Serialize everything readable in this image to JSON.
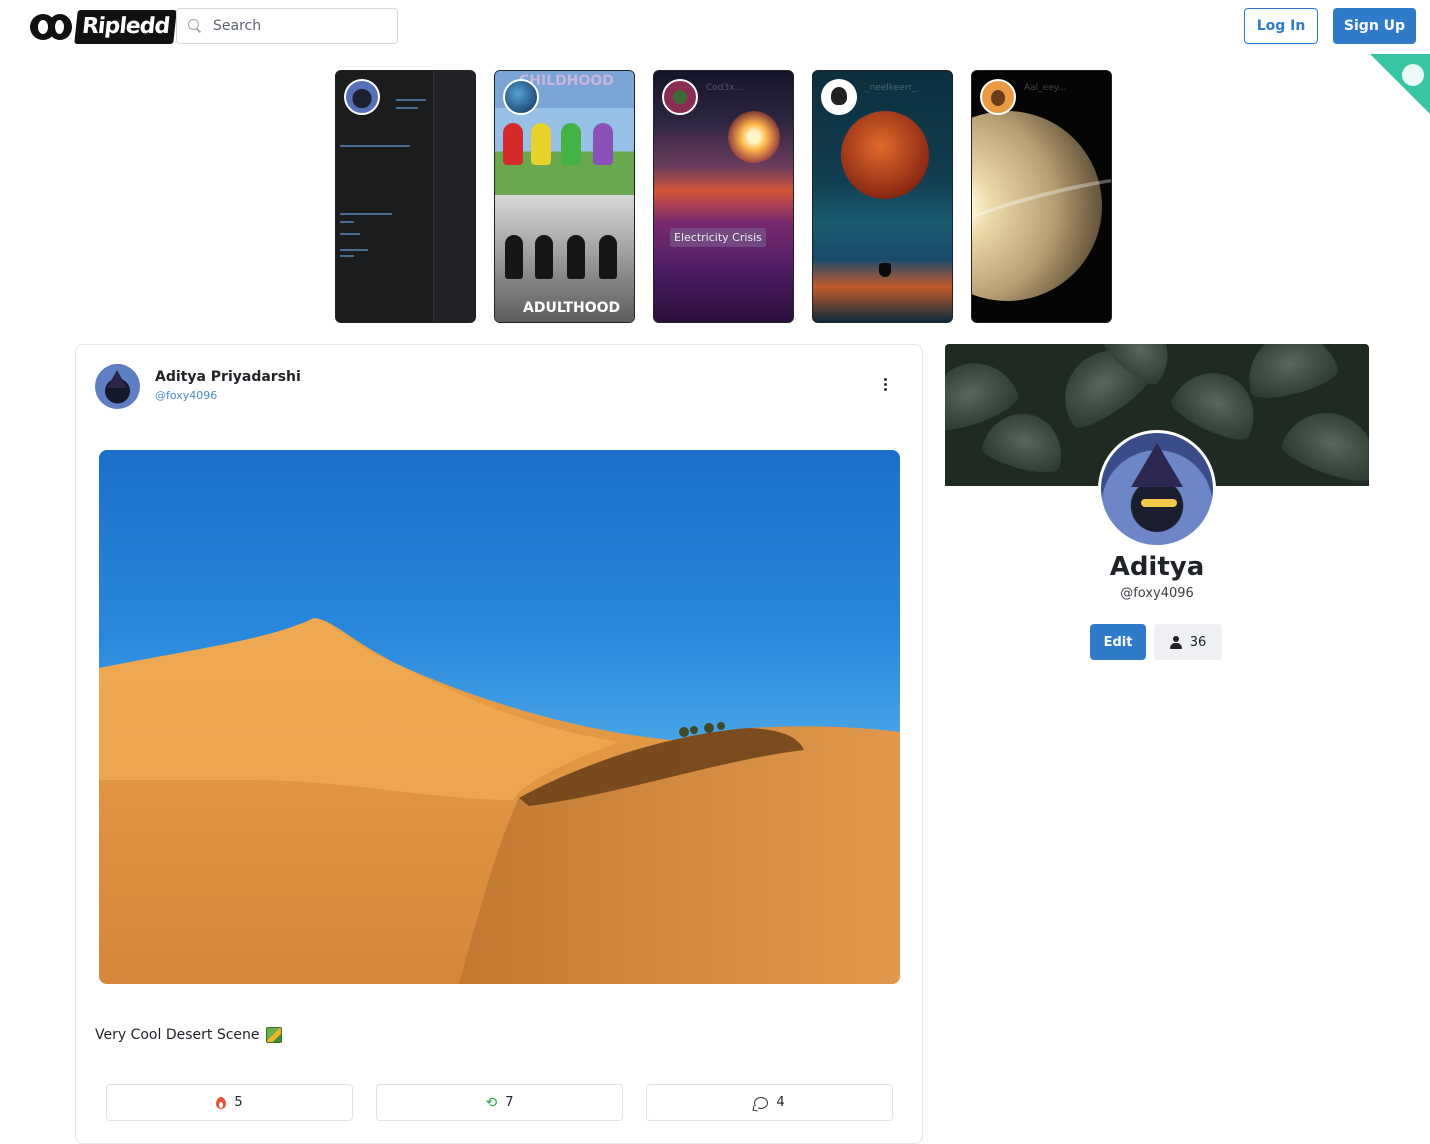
{
  "header": {
    "logo_text": "Ripledd",
    "search_placeholder": "Search",
    "login_label": "Log In",
    "signup_label": "Sign Up"
  },
  "stories": [
    {
      "id": "code",
      "caption": ""
    },
    {
      "id": "teletubbies",
      "caption": "",
      "top_text": "CHILDHOOD",
      "bottom_text": "ADULTHOOD"
    },
    {
      "id": "electricity",
      "caption": "Cod3x...",
      "overlay_text": "Electricity Crisis"
    },
    {
      "id": "moon",
      "caption": "_neelkeerr_"
    },
    {
      "id": "planet",
      "caption": "Aal_eey..."
    }
  ],
  "post": {
    "author_name": "Aditya Priyadarshi",
    "author_handle": "@foxy4096",
    "caption": "Very Cool Desert Scene",
    "caption_emoji": "map-emoji",
    "likes": "5",
    "reposts": "7",
    "comments": "4"
  },
  "profile": {
    "name": "Aditya",
    "handle": "@foxy4096",
    "edit_label": "Edit",
    "followers": "36"
  },
  "colors": {
    "accent": "#2f7bc9",
    "handle": "#4a8bd1",
    "ribbon": "#36c6a3",
    "like": "#e5533b",
    "repost": "#2da44e"
  }
}
